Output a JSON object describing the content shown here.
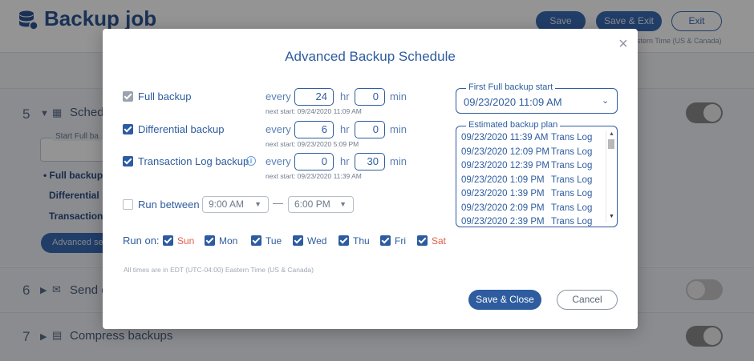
{
  "background": {
    "app_title": "Backup job",
    "header_buttons": {
      "save": "Save",
      "save_exit": "Save & Exit",
      "exit": "Exit"
    },
    "header_timezone": "Eastern Time (US & Canada)",
    "sections": [
      {
        "number": "5",
        "title": "Schedu",
        "icon": "calendar-icon",
        "toggle_on": true
      },
      {
        "number": "6",
        "title": "Send e",
        "icon": "envelope-icon",
        "toggle_on": false
      },
      {
        "number": "7",
        "title": "Compress backups",
        "icon": "archive-icon",
        "toggle_on": true
      }
    ],
    "start_full_label": "Start Full ba",
    "schedule_items": [
      "• Full backup",
      "Differential",
      "Transaction"
    ],
    "advanced_button": "Advanced se"
  },
  "modal": {
    "title": "Advanced Backup Schedule",
    "close_icon": "close-icon",
    "every_label": "every",
    "hr_label": "hr",
    "min_label": "min",
    "rows": [
      {
        "label": "Full backup",
        "checked": true,
        "disabled": true,
        "hours": "24",
        "minutes": "0",
        "next_start": "next start: 09/24/2020 11:09 AM"
      },
      {
        "label": "Differential backup",
        "checked": true,
        "disabled": false,
        "hours": "6",
        "minutes": "0",
        "next_start": "next start: 09/23/2020 5:09 PM"
      },
      {
        "label": "Transaction Log backup",
        "checked": true,
        "disabled": false,
        "hours": "0",
        "minutes": "30",
        "next_start": "next start: 09/23/2020 11:39 AM"
      }
    ],
    "info_icon": "i",
    "run_between": {
      "label": "Run between",
      "checked": false,
      "from": "9:00 AM",
      "to": "6:00 PM",
      "separator": "—"
    },
    "run_on": {
      "label": "Run on:",
      "days": [
        {
          "name": "Sun",
          "checked": true,
          "weekend": true
        },
        {
          "name": "Mon",
          "checked": true,
          "weekend": false
        },
        {
          "name": "Tue",
          "checked": true,
          "weekend": false
        },
        {
          "name": "Wed",
          "checked": true,
          "weekend": false
        },
        {
          "name": "Thu",
          "checked": true,
          "weekend": false
        },
        {
          "name": "Fri",
          "checked": true,
          "weekend": false
        },
        {
          "name": "Sat",
          "checked": true,
          "weekend": true
        }
      ]
    },
    "timezone_note": "All times are in EDT (UTC-04:00) Eastern Time (US & Canada)",
    "first_full": {
      "label": "First Full backup start",
      "value": "09/23/2020 11:09 AM"
    },
    "plan": {
      "label": "Estimated backup plan",
      "rows": [
        {
          "time": "09/23/2020 11:39 AM",
          "type": "Trans Log"
        },
        {
          "time": "09/23/2020 12:09 PM",
          "type": "Trans Log"
        },
        {
          "time": "09/23/2020 12:39 PM",
          "type": "Trans Log"
        },
        {
          "time": "09/23/2020 1:09 PM",
          "type": "Trans Log"
        },
        {
          "time": "09/23/2020 1:39 PM",
          "type": "Trans Log"
        },
        {
          "time": "09/23/2020 2:09 PM",
          "type": "Trans Log"
        },
        {
          "time": "09/23/2020 2:39 PM",
          "type": "Trans Log"
        }
      ]
    },
    "save_close": "Save & Close",
    "cancel": "Cancel"
  },
  "colors": {
    "accent": "#2e5c9f",
    "weekend": "#e05f4a",
    "overlay": "#000000"
  }
}
